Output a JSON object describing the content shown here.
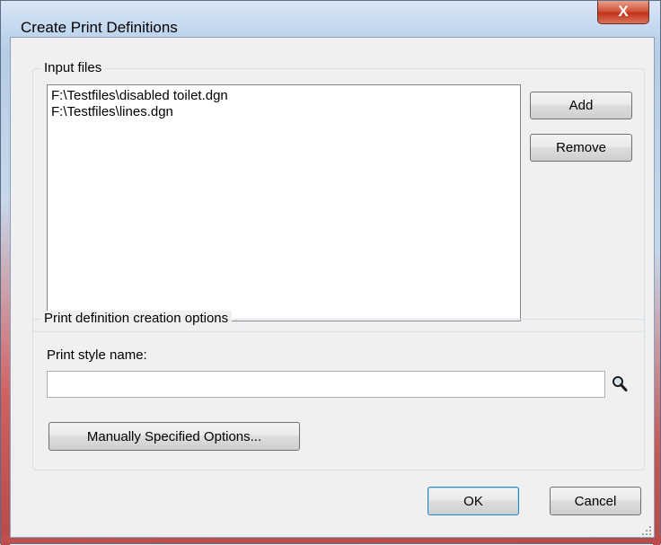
{
  "window": {
    "title": "Create Print Definitions",
    "close_label": "X"
  },
  "input_files": {
    "legend": "Input files",
    "files": [
      "F:\\Testfiles\\disabled toilet.dgn",
      "F:\\Testfiles\\lines.dgn"
    ],
    "add_label": "Add",
    "remove_label": "Remove"
  },
  "options": {
    "legend": "Print definition creation options",
    "print_style_label": "Print style name:",
    "print_style_value": "",
    "manual_options_label": "Manually Specified Options..."
  },
  "footer": {
    "ok_label": "OK",
    "cancel_label": "Cancel"
  }
}
